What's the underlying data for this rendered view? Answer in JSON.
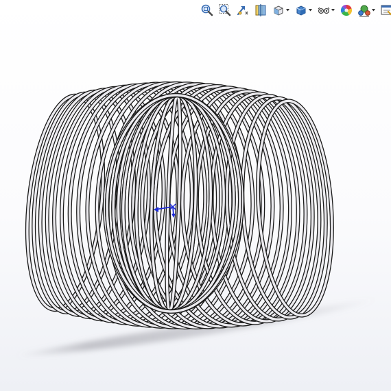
{
  "view_toolbar": {
    "items": [
      {
        "icon": "zoom-to-fit-icon",
        "has_dropdown": false
      },
      {
        "icon": "zoom-to-area-icon",
        "has_dropdown": false
      },
      {
        "icon": "previous-view-icon",
        "has_dropdown": false
      },
      {
        "icon": "section-view-icon",
        "has_dropdown": false
      },
      {
        "icon": "view-orientation-icon",
        "has_dropdown": true
      },
      {
        "icon": "display-style-icon",
        "has_dropdown": true
      },
      {
        "icon": "hide-show-items-icon",
        "has_dropdown": true
      },
      {
        "icon": "edit-appearance-icon",
        "has_dropdown": false
      },
      {
        "icon": "apply-scene-icon",
        "has_dropdown": true
      },
      {
        "icon": "view-settings-icon",
        "has_dropdown": true
      }
    ]
  },
  "graphics_area": {
    "model": "spring-coil-assembly",
    "triad_axes": [
      "x",
      "y",
      "z"
    ]
  },
  "colors": {
    "background_top": "#ffffff",
    "background_bottom": "#eef0f5",
    "coil_fill": "#ecebef",
    "coil_edge": "#1a1a1a",
    "triad": "#1d2bd8",
    "shadow": "#9a9aa2"
  }
}
